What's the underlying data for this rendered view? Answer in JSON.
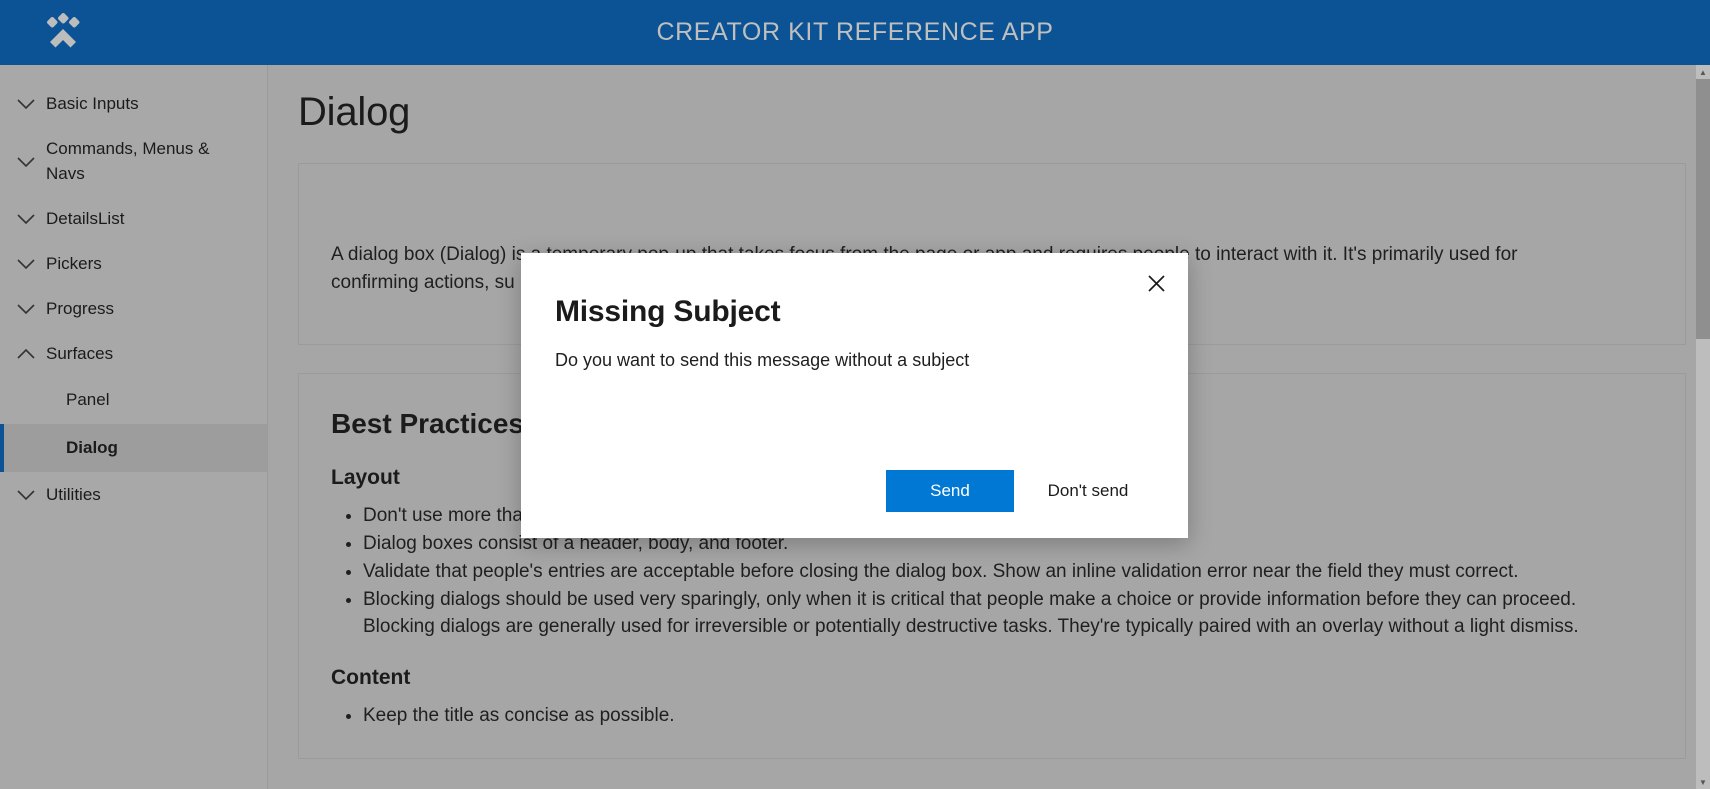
{
  "header": {
    "title": "CREATOR KIT REFERENCE APP",
    "logo_icon": "paw-logo-icon",
    "background_color": "#0b5394",
    "title_color": "#bfbfbf"
  },
  "sidebar": {
    "groups": [
      {
        "label": "Basic Inputs",
        "expanded": false,
        "chevron": "chevron-down-icon"
      },
      {
        "label": "Commands, Menus & Navs",
        "expanded": false,
        "chevron": "chevron-down-icon"
      },
      {
        "label": "DetailsList",
        "expanded": false,
        "chevron": "chevron-down-icon"
      },
      {
        "label": "Pickers",
        "expanded": false,
        "chevron": "chevron-down-icon"
      },
      {
        "label": "Progress",
        "expanded": false,
        "chevron": "chevron-down-icon"
      },
      {
        "label": "Surfaces",
        "expanded": true,
        "chevron": "chevron-up-icon"
      },
      {
        "label": "Utilities",
        "expanded": false,
        "chevron": "chevron-down-icon"
      }
    ],
    "surfaces_children": [
      {
        "label": "Panel",
        "selected": false
      },
      {
        "label": "Dialog",
        "selected": true
      }
    ],
    "selected_accent_color": "#0b5394",
    "background_color": "#a8a8a8"
  },
  "main": {
    "page_title": "Dialog",
    "intro": "A dialog box (Dialog) is a temporary pop-up that takes focus from the page or app and requires people to interact with it. It's primarily used for confirming actions, su",
    "best_practices_heading": "Best Practices",
    "layout_heading": "Layout",
    "layout_bullets": [
      "Don't use more than three buttons.",
      "Dialog boxes consist of a header, body, and footer.",
      "Validate that people's entries are acceptable before closing the dialog box. Show an inline validation error near the field they must correct.",
      "Blocking dialogs should be used very sparingly, only when it is critical that people make a choice or provide information before they can proceed. Blocking dialogs are generally used for irreversible or potentially destructive tasks. They're typically paired with an overlay without a light dismiss."
    ],
    "content_heading": "Content",
    "content_bullets": [
      "Keep the title as concise as possible."
    ]
  },
  "scrollbar": {
    "up_arrow": "scroll-up-arrow-icon",
    "down_arrow": "scroll-down-arrow-icon"
  },
  "dialog": {
    "title": "Missing Subject",
    "subtext": "Do you want to send this message without a subject",
    "close_icon": "close-icon",
    "primary_button": "Send",
    "secondary_button": "Don't send",
    "primary_color": "#0078d4"
  }
}
